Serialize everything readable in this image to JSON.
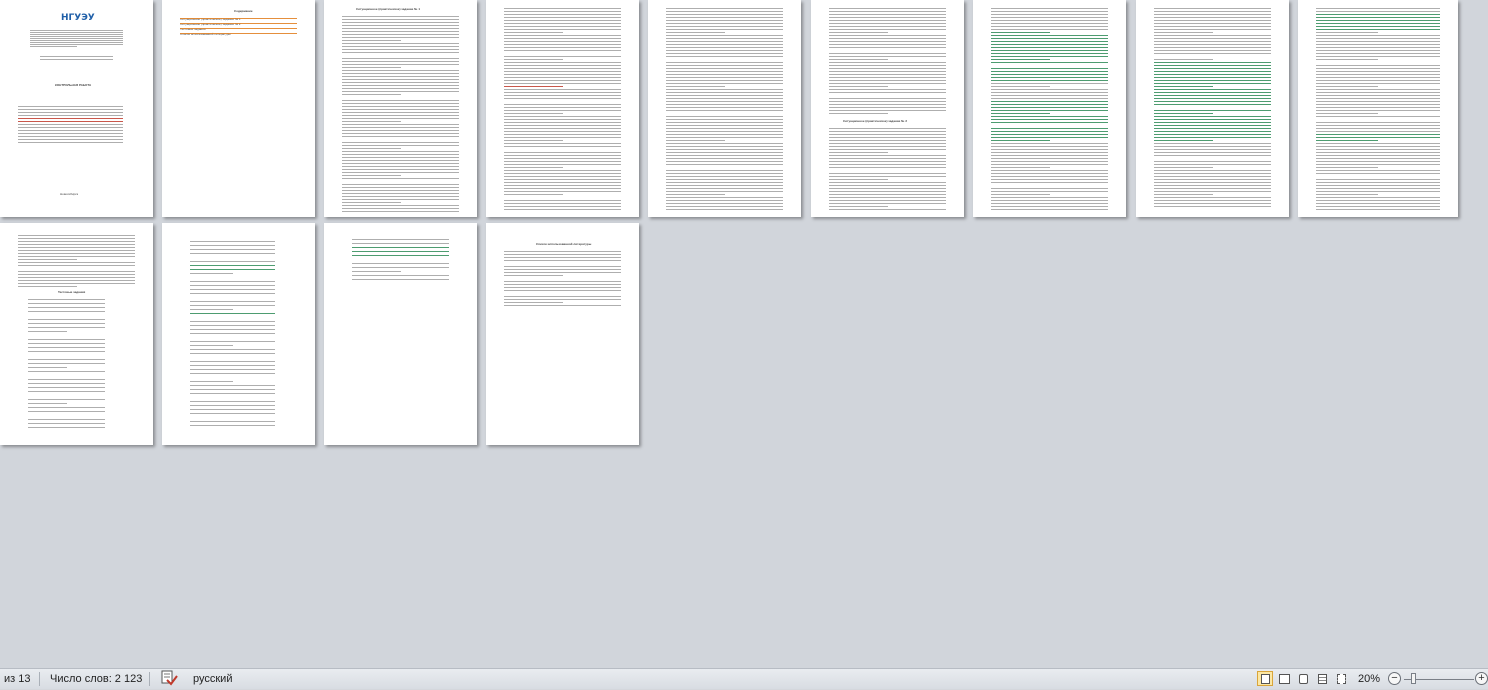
{
  "document": {
    "logo_text": "НГУЭУ",
    "title_page_heading": "КОНТРОЛЬНАЯ РАБОТА",
    "title_page_footer": "Новосибирск",
    "toc_heading": "Содержание",
    "toc_items": [
      "Ситуационное (практическое) задание № 1",
      "Ситуационное (практическое) задание № 2",
      "Тестовые задания",
      "Список использованной литературы"
    ],
    "section_1_heading": "Ситуационное (практическое) задание № 1",
    "section_2_heading": "Ситуационное (практическое) задание № 2",
    "tests_heading": "Тестовые задания",
    "bibliography_heading": "Список использованной литературы"
  },
  "statusbar": {
    "page_label": "из 13",
    "word_count": "Число слов: 2 123",
    "language": "русский",
    "zoom": "20%",
    "zoom_out": "−",
    "zoom_in": "+"
  },
  "colors": {
    "canvas": "#d1d5db",
    "page": "#ffffff",
    "highlight_red": "#c0392b",
    "highlight_green": "#2e8b57",
    "highlight_orange": "#e07b1a"
  }
}
